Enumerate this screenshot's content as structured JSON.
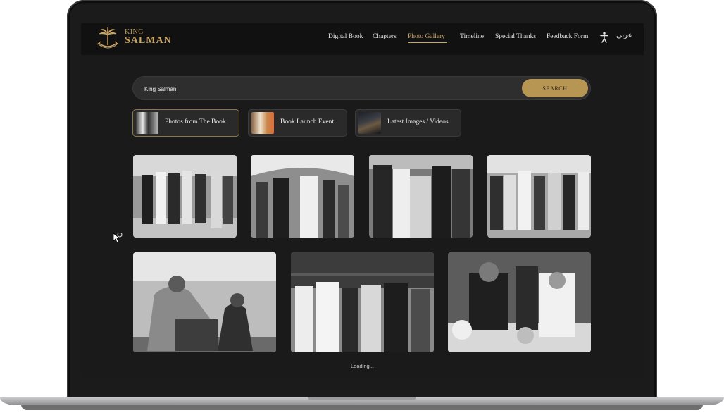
{
  "brand": {
    "line1": "KING",
    "line2": "SALMAN",
    "emblem": "palm-and-swords-emblem",
    "color": "#c9a566"
  },
  "nav": {
    "items": [
      {
        "label": "Digital Book",
        "active": false
      },
      {
        "label": "Chapters",
        "active": false
      },
      {
        "label": "Photo Gallery",
        "active": true
      },
      {
        "label": "Timeline",
        "active": false
      },
      {
        "label": "Special Thanks",
        "active": false
      },
      {
        "label": "Feedback Form",
        "active": false
      }
    ],
    "accessibility_icon": "accessibility-icon",
    "language_label": "عربي"
  },
  "search": {
    "value": "King Salman",
    "button_label": "SEARCH",
    "button_color": "#b79654"
  },
  "tabs": [
    {
      "label": "Photos from The Book",
      "active": true
    },
    {
      "label": "Book Launch Event",
      "active": false
    },
    {
      "label": "Latest Images / Videos",
      "active": false
    }
  ],
  "gallery": {
    "status_text": "Loading..."
  }
}
